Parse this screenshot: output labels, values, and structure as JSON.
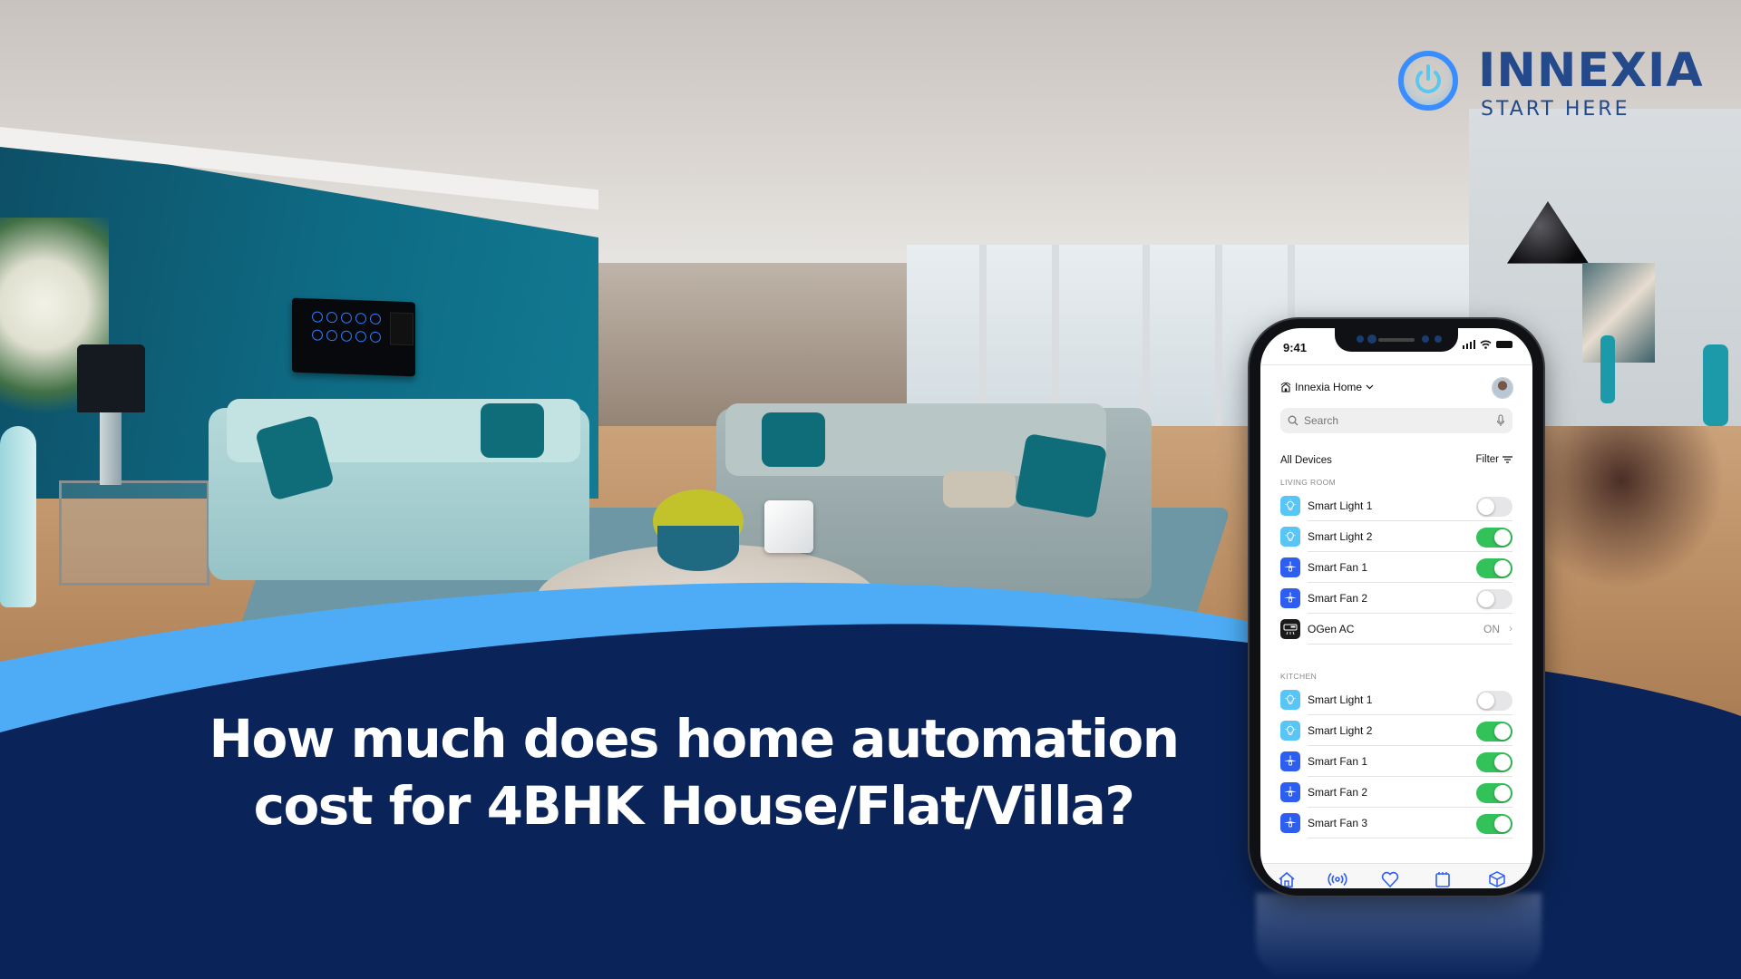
{
  "brand": {
    "name": "INNEXIA",
    "tagline": "START HERE",
    "logo_icon": "power-icon",
    "colors": {
      "primary": "#244a8c",
      "ring": "#3a8dff",
      "power": "#58c8f0"
    }
  },
  "headline": {
    "line1": "How much does home automation",
    "line2": "cost for 4BHK House/Flat/Villa?"
  },
  "colors": {
    "navy_band": "#0a2459",
    "light_band": "#4dacf5",
    "toggle_on": "#33c159",
    "toggle_off": "#e6e6e8",
    "light_icon_bg": "#57c5f5",
    "fan_icon_bg": "#2e5ef0"
  },
  "phone": {
    "status_bar": {
      "time": "9:41",
      "icons": [
        "signal-icon",
        "wifi-icon",
        "battery-icon"
      ]
    },
    "header": {
      "home_name": "Innexia Home",
      "home_icon": "smart-home-icon",
      "dropdown_icon": "chevron-down-icon",
      "avatar": "user-avatar"
    },
    "search": {
      "placeholder": "Search",
      "icon": "search-icon",
      "mic_icon": "microphone-icon"
    },
    "list_header": {
      "title": "All Devices",
      "filter_label": "Filter",
      "filter_icon": "filter-icon"
    },
    "sections": [
      {
        "label": "LIVING ROOM",
        "devices": [
          {
            "name": "Smart Light 1",
            "type": "light",
            "icon": "bulb-icon",
            "state": "off"
          },
          {
            "name": "Smart Light 2",
            "type": "light",
            "icon": "bulb-icon",
            "state": "on"
          },
          {
            "name": "Smart Fan 1",
            "type": "fan",
            "icon": "ceiling-fan-icon",
            "state": "on"
          },
          {
            "name": "Smart Fan 2",
            "type": "fan",
            "icon": "ceiling-fan-icon",
            "state": "off"
          },
          {
            "name": "OGen AC",
            "type": "ac",
            "icon": "air-conditioner-icon",
            "status_text": "ON"
          }
        ]
      },
      {
        "label": "KITCHEN",
        "devices": [
          {
            "name": "Smart Light 1",
            "type": "light",
            "icon": "bulb-icon",
            "state": "off"
          },
          {
            "name": "Smart Light 2",
            "type": "light",
            "icon": "bulb-icon",
            "state": "on"
          },
          {
            "name": "Smart Fan 1",
            "type": "fan",
            "icon": "ceiling-fan-icon",
            "state": "on"
          },
          {
            "name": "Smart Fan 2",
            "type": "fan",
            "icon": "ceiling-fan-icon",
            "state": "on"
          },
          {
            "name": "Smart Fan 3",
            "type": "fan",
            "icon": "ceiling-fan-icon",
            "state": "on"
          }
        ]
      }
    ],
    "tabbar": [
      "home-icon",
      "broadcast-icon",
      "heart-icon",
      "calendar-icon",
      "cube-icon"
    ]
  }
}
